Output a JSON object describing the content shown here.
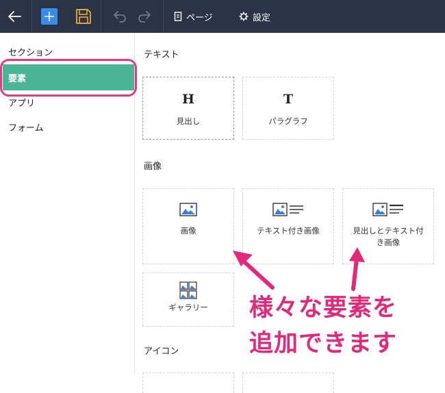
{
  "toolbar": {
    "page_label": "ページ",
    "settings_label": "設定"
  },
  "sidebar": {
    "items": [
      {
        "label": "セクション"
      },
      {
        "label": "要素"
      },
      {
        "label": "アプリ"
      },
      {
        "label": "フォーム"
      }
    ],
    "active_item": "要素"
  },
  "sections": {
    "text": {
      "title": "テキスト",
      "cards": [
        {
          "glyph": "H",
          "label": "見出し"
        },
        {
          "glyph": "T",
          "label": "パラグラフ"
        }
      ]
    },
    "image": {
      "title": "画像",
      "cards": [
        {
          "label": "画像",
          "icon": "image-icon"
        },
        {
          "label": "テキスト付き画像",
          "icon": "image-text-icon"
        },
        {
          "label_line1": "見出しとテキスト付",
          "label_line2": "き画像",
          "icon": "image-heading-text-icon"
        },
        {
          "label": "ギャラリー",
          "icon": "gallery-icon"
        }
      ]
    },
    "icon": {
      "title": "アイコン"
    }
  },
  "annotation": {
    "line1": "様々な要素を",
    "line2": "追加できます"
  },
  "colors": {
    "toolbar_bg": "#2b3446",
    "add_button": "#3b8beb",
    "save_icon": "#e8a93a",
    "active_item": "#4ab497",
    "annotation": "#e0297a"
  }
}
